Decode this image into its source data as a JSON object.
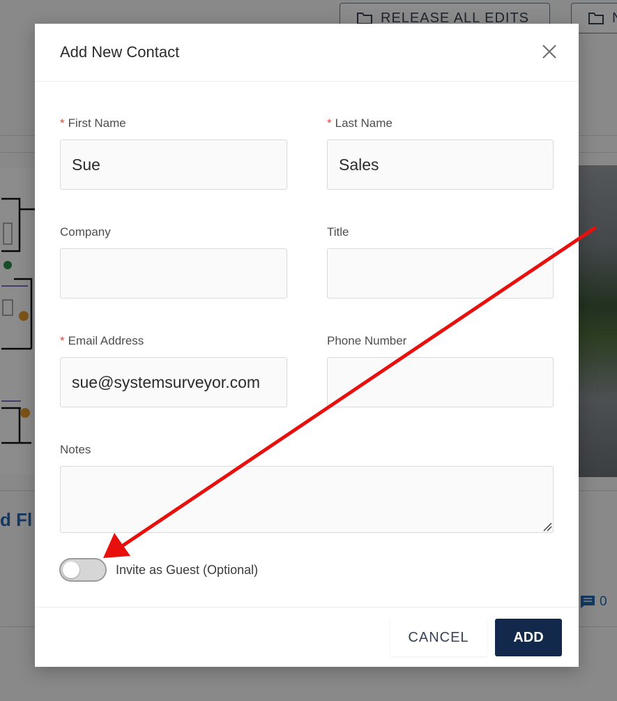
{
  "background": {
    "buttons": [
      {
        "label": "RELEASE ALL EDITS"
      },
      {
        "label": "N"
      }
    ],
    "card_title": "d Fl",
    "comment_count": "0"
  },
  "modal": {
    "title": "Add New Contact",
    "fields": {
      "first_name": {
        "label": "First Name",
        "value": "Sue",
        "required": true
      },
      "last_name": {
        "label": "Last Name",
        "value": "Sales",
        "required": true
      },
      "company": {
        "label": "Company",
        "value": ""
      },
      "title": {
        "label": "Title",
        "value": ""
      },
      "email": {
        "label": "Email Address",
        "value": "sue@systemsurveyor.com",
        "required": true
      },
      "phone": {
        "label": "Phone Number",
        "value": ""
      },
      "notes": {
        "label": "Notes",
        "value": ""
      }
    },
    "required_marker": "*",
    "invite_toggle": {
      "label": "Invite as Guest (Optional)",
      "on": false
    },
    "footer": {
      "cancel_label": "CANCEL",
      "add_label": "ADD"
    }
  },
  "colors": {
    "primary": "#13294b",
    "required": "#e0463a",
    "annotation_arrow": "#e8100c",
    "link": "#2468b3"
  }
}
